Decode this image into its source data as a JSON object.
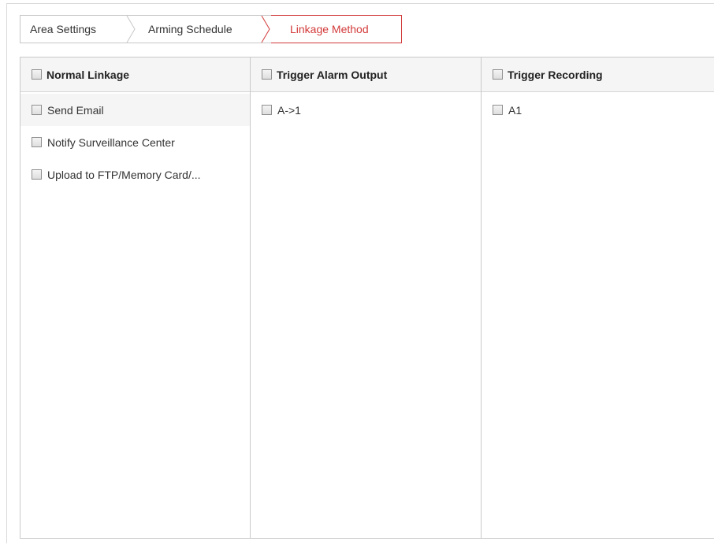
{
  "tabs": [
    {
      "label": "Area Settings",
      "active": false
    },
    {
      "label": "Arming Schedule",
      "active": false
    },
    {
      "label": "Linkage Method",
      "active": true
    }
  ],
  "columns": [
    {
      "header": "Normal Linkage",
      "header_checked": false,
      "items": [
        {
          "label": "Send Email",
          "checked": false
        },
        {
          "label": "Notify Surveillance Center",
          "checked": false
        },
        {
          "label": "Upload to FTP/Memory Card/...",
          "checked": false
        }
      ]
    },
    {
      "header": "Trigger Alarm Output",
      "header_checked": false,
      "items": [
        {
          "label": "A->1",
          "checked": false
        }
      ]
    },
    {
      "header": "Trigger Recording",
      "header_checked": false,
      "items": [
        {
          "label": "A1",
          "checked": false
        }
      ]
    }
  ],
  "colors": {
    "active_tab": "#d33a3a",
    "border": "#c9c9c9",
    "header_bg": "#f5f5f5"
  },
  "icons": {
    "tab_separator": "chevron-right-icon",
    "checkbox": "checkbox-unchecked-icon"
  }
}
